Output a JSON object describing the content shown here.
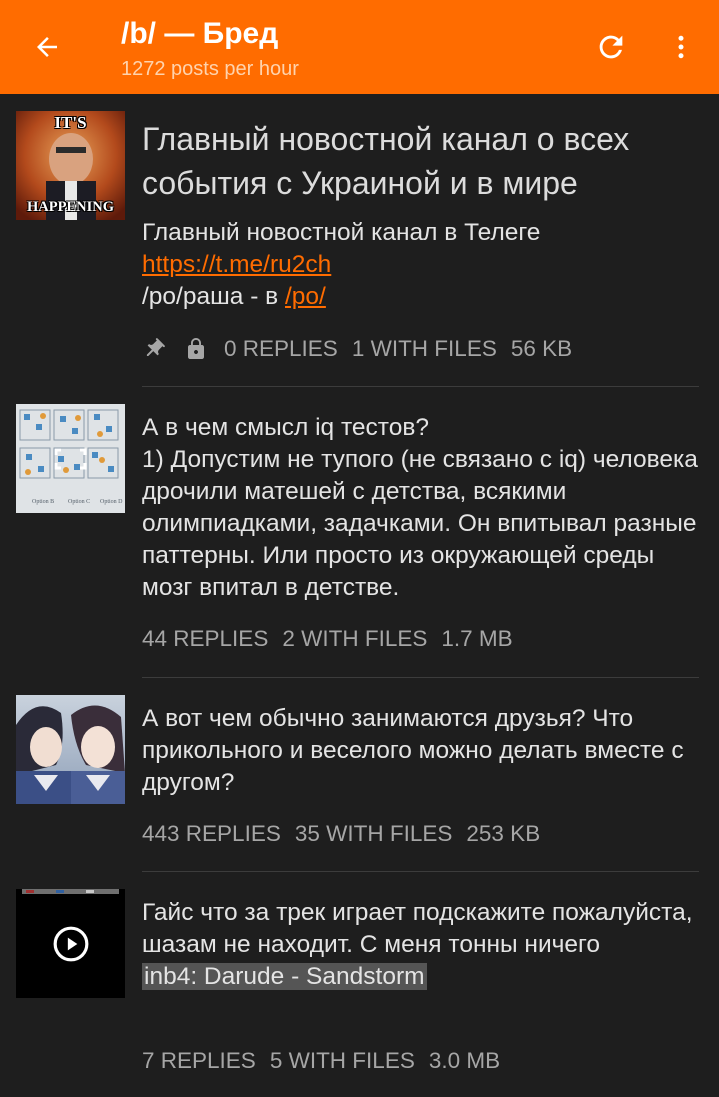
{
  "header": {
    "title": "/b/ — Бред",
    "subtitle": "1272 posts per hour",
    "back_icon": "arrow-back-icon",
    "refresh_icon": "refresh-icon",
    "more_icon": "more-vertical-icon"
  },
  "colors": {
    "accent": "#ff6c00",
    "background": "#1e1e1e",
    "meta_text": "#a6a6a6"
  },
  "posts": [
    {
      "thumb_text_top": "IT'S",
      "thumb_text_bottom": "HAPPENING",
      "title": "Главный новостной канал о всех события с Украиной и в мире",
      "line1": "Главный новостной канал в Телеге",
      "link1": "https://t.me/ru2ch",
      "line3_prefix": "/po/раша - в ",
      "link2": "/po/",
      "pinned_icon": "pin-icon",
      "locked_icon": "lock-icon",
      "replies": "0 REPLIES",
      "files": "1 WITH FILES",
      "size": "56 KB"
    },
    {
      "text": "А в чем смысл iq тестов?\n1) Допустим не тупого (не связано с iq) человека дрочили матешей с детства, всякими олимпиадками, задачками. Он впитывал разные паттерны. Или просто из окружающей среды мозг впитал в детстве.",
      "thumb_caption_1": "Option B",
      "thumb_caption_2": "Option C",
      "thumb_caption_3": "Option D",
      "replies": "44 REPLIES",
      "files": "2 WITH FILES",
      "size": "1.7 MB"
    },
    {
      "text": "А вот чем обычно занимаются друзья? Что прикольного и веселого можно делать вместе с другом?",
      "replies": "443 REPLIES",
      "files": "35 WITH FILES",
      "size": "253 KB"
    },
    {
      "text": "Гайс что за трек играет подскажите пожалуйста, шазам не находит. С меня тонны ничего",
      "spoiler": "inb4: Darude - Sandstorm",
      "play_icon": "play-circle-icon",
      "replies": "7 REPLIES",
      "files": "5 WITH FILES",
      "size": "3.0 MB"
    }
  ]
}
